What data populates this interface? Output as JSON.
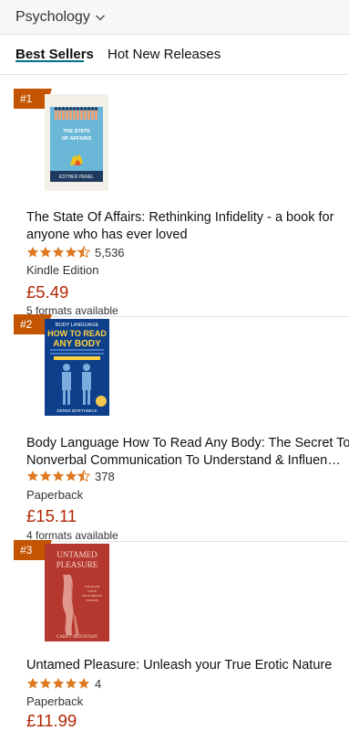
{
  "header": {
    "category": "Psychology"
  },
  "tabs": [
    {
      "label": "Best Sellers",
      "active": true
    },
    {
      "label": "Hot New Releases",
      "active": false
    }
  ],
  "items": [
    {
      "rank": "#1",
      "cover_text": {
        "title": "THE STATE OF AFFAIRS",
        "author": "ESTHER PEREL"
      },
      "title_line1": "The State Of Affairs: Rethinking Infidelity - a book for",
      "title_line2": "anyone who has ever loved",
      "rating": 4.5,
      "rating_count": "5,536",
      "format": "Kindle Edition",
      "price": "£5.49",
      "formats_available": "5 formats available"
    },
    {
      "rank": "#2",
      "cover_text": {
        "top": "BODY LANGUAGE",
        "title1": "HOW TO READ",
        "title2": "ANY BODY",
        "author": "DEREK BORTHWICK"
      },
      "title_line1": "Body Language How To Read Any Body: The Secret To",
      "title_line2": "Nonverbal Communication To Understand & Influence…",
      "rating": 4.5,
      "rating_count": "378",
      "format": "Paperback",
      "price": "£15.11",
      "formats_available": "4 formats available"
    },
    {
      "rank": "#3",
      "cover_text": {
        "title1": "UNTAMED",
        "title2": "PLEASURE",
        "author": "CAREY MOUNTAIN"
      },
      "title_line1": "Untamed Pleasure: Unleash your True Erotic Nature",
      "rating": 5,
      "rating_count": "4",
      "format": "Paperback",
      "price": "£11.99"
    }
  ],
  "colors": {
    "accent": "#007185",
    "badge": "#c45500",
    "price": "#b12704",
    "star": "#de7921"
  }
}
